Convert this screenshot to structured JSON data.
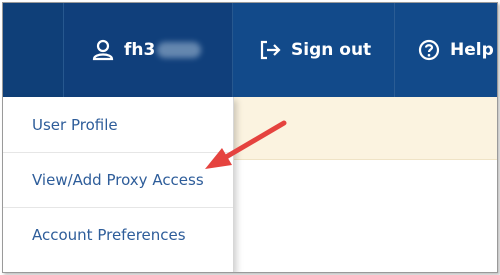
{
  "nav": {
    "username": "fh3",
    "signout_label": "Sign out",
    "help_label": "Help"
  },
  "menu": {
    "items": [
      {
        "label": "User Profile"
      },
      {
        "label": "View/Add Proxy Access"
      },
      {
        "label": "Account Preferences"
      }
    ]
  },
  "icons": {
    "user": "user-icon",
    "signout": "sign-out-icon",
    "help": "help-icon",
    "annotation": "red-arrow-annotation"
  },
  "colors": {
    "nav_background": "#124a8a",
    "menu_text": "#2e5d9a",
    "banner_background": "#fbf3e0",
    "annotation_arrow": "#e5433f"
  }
}
